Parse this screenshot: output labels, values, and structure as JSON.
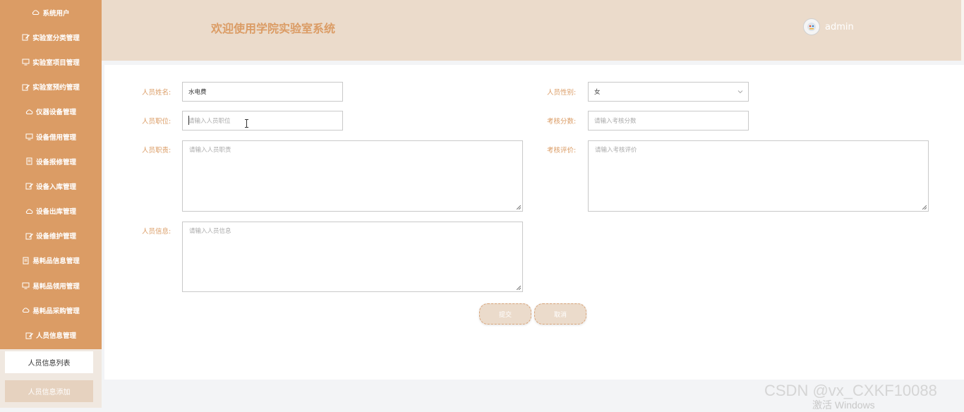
{
  "sidebar": {
    "items": [
      {
        "label": "系统用户",
        "icon": "cloud-icon"
      },
      {
        "label": "实验室分类管理",
        "icon": "edit-icon"
      },
      {
        "label": "实验室项目管理",
        "icon": "monitor-icon"
      },
      {
        "label": "实验室预约管理",
        "icon": "edit-icon"
      },
      {
        "label": "仪器设备管理",
        "icon": "cloud-icon"
      },
      {
        "label": "设备借用管理",
        "icon": "monitor-icon"
      },
      {
        "label": "设备报修管理",
        "icon": "document-icon"
      },
      {
        "label": "设备入库管理",
        "icon": "edit-icon"
      },
      {
        "label": "设备出库管理",
        "icon": "cloud-icon"
      },
      {
        "label": "设备维护管理",
        "icon": "edit-icon"
      },
      {
        "label": "易耗品信息管理",
        "icon": "document-icon"
      },
      {
        "label": "易耗品领用管理",
        "icon": "monitor-icon"
      },
      {
        "label": "易耗品采购管理",
        "icon": "cloud-icon"
      },
      {
        "label": "人员信息管理",
        "icon": "edit-icon"
      }
    ],
    "submenu": {
      "list": "人员信息列表",
      "add": "人员信息添加"
    }
  },
  "header": {
    "title": "欢迎使用学院实验室系统",
    "username": "admin"
  },
  "form": {
    "name_label": "人员姓名:",
    "name_value": "水电费",
    "gender_label": "人员性别:",
    "gender_value": "女",
    "position_label": "人员职位:",
    "position_placeholder": "请输入人员职位",
    "score_label": "考核分数:",
    "score_placeholder": "请输入考核分数",
    "duty_label": "人员职责:",
    "duty_placeholder": "请输入人员职责",
    "eval_label": "考核评价:",
    "eval_placeholder": "请输入考核评价",
    "info_label": "人员信息:",
    "info_placeholder": "请输入人员信息",
    "submit": "提交",
    "cancel": "取消"
  },
  "overlay": {
    "watermark": "CSDN @vx_CXKF10088",
    "activation": "激活 Windows"
  },
  "colors": {
    "accent": "#db9c65",
    "header_bg": "#ebdbcb",
    "label": "#db9c65"
  }
}
